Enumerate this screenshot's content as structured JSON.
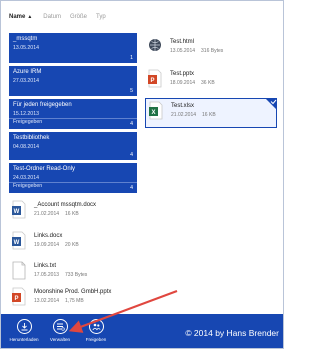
{
  "sort": {
    "name_label": "Name",
    "date_label": "Datum",
    "size_label": "Größe",
    "type_label": "Typ"
  },
  "folders": [
    {
      "name": "_mssqtm",
      "date": "13.05.2014",
      "sub": "",
      "count": "1"
    },
    {
      "name": "Azure IRM",
      "date": "27.03.2014",
      "sub": "",
      "count": "5"
    },
    {
      "name": "Für jeden freigegeben",
      "date": "15.12.2013",
      "sub": "Freigegeben",
      "count": "4"
    },
    {
      "name": "Testbibliothek",
      "date": "04.08.2014",
      "sub": "",
      "count": "4"
    },
    {
      "name": "Test-Ordner Read-Only",
      "date": "24.03.2014",
      "sub": "Freigegeben",
      "count": "4"
    }
  ],
  "right_files": [
    {
      "name": "Test.html",
      "date": "13.05.2014",
      "size": "316 Bytes",
      "icon": "html-file-icon"
    },
    {
      "name": "Test.pptx",
      "date": "18.09.2014",
      "size": "36 KB",
      "icon": "powerpoint-file-icon"
    },
    {
      "name": "Test.xlsx",
      "date": "21.02.2014",
      "size": "16 KB",
      "icon": "excel-file-icon"
    }
  ],
  "left_files": [
    {
      "name": "_Account mssqtm.docx",
      "date": "21.02.2014",
      "size": "16 KB",
      "icon": "word-file-icon"
    },
    {
      "name": "Links.docx",
      "date": "19.09.2014",
      "size": "20 KB",
      "icon": "word-file-icon"
    },
    {
      "name": "Links.txt",
      "date": "17.05.2013",
      "size": "733 Bytes",
      "icon": "text-file-icon"
    },
    {
      "name": "Moonshine Prod. GmbH.pptx",
      "date": "13.02.2014",
      "size": "1,75 MB",
      "icon": "powerpoint-file-icon"
    }
  ],
  "appbar": {
    "download_label": "Herunterladen",
    "manage_label": "Verwalten",
    "share_label": "Freigeben",
    "copyright": "© 2014 by Hans Brender"
  },
  "colors": {
    "accent": "#1747b2",
    "annotation_arrow": "#e0473f"
  }
}
